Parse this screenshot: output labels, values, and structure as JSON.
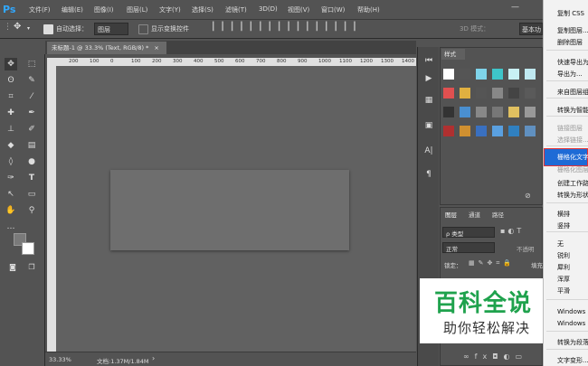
{
  "app": {
    "logo": "Ps"
  },
  "menu": [
    "文件(F)",
    "编辑(E)",
    "图像(I)",
    "图层(L)",
    "文字(Y)",
    "选择(S)",
    "滤镜(T)",
    "3D(D)",
    "视图(V)",
    "窗口(W)",
    "帮助(H)"
  ],
  "options": {
    "auto_select": "自动选择：",
    "auto_select_value": "图层",
    "show_transform": "显示变换控件",
    "mode_3d": "3D 模式：",
    "workspace": "基本功"
  },
  "document": {
    "tab_title": "未标题-1 @ 33.3% (Text, RGB/8) *",
    "close": "×"
  },
  "ruler_ticks": [
    "200",
    "100",
    "0",
    "100",
    "200",
    "300",
    "400",
    "500",
    "600",
    "700",
    "800",
    "900",
    "1000",
    "1100",
    "1200",
    "1300",
    "1400"
  ],
  "status": {
    "zoom": "33.33%",
    "doc": "文档:1.37M/1.84M"
  },
  "styles_panel": {
    "tab": "样式"
  },
  "layers_panel": {
    "tabs": [
      "图层",
      "通道",
      "路径"
    ],
    "filter": "ρ 类型",
    "blend": "正常",
    "opacity": "不透明",
    "lock": "锁定：",
    "fill": "填充"
  },
  "context_menu": [
    {
      "label": "复制 CSS",
      "disabled": false
    },
    {
      "label": "复制图层...",
      "disabled": false
    },
    {
      "label": "删除图层",
      "disabled": false
    },
    {
      "label": "快速导出为...",
      "disabled": false
    },
    {
      "label": "导出为...",
      "disabled": false
    },
    {
      "label": "来自图层组...",
      "disabled": false
    },
    {
      "label": "转换为智能...",
      "disabled": false
    },
    {
      "label": "链接图层",
      "disabled": true
    },
    {
      "label": "选择链接...",
      "disabled": true
    },
    {
      "label": "栅格化文字",
      "disabled": false,
      "highlighted": true
    },
    {
      "label": "栅格化图层...",
      "disabled": true
    },
    {
      "label": "创建工作路径",
      "disabled": false
    },
    {
      "label": "转换为形状",
      "disabled": false
    },
    {
      "label": "横排",
      "disabled": false
    },
    {
      "label": "竖排",
      "disabled": false
    },
    {
      "label": "无",
      "disabled": false
    },
    {
      "label": "锐利",
      "disabled": false
    },
    {
      "label": "犀利",
      "disabled": false
    },
    {
      "label": "浑厚",
      "disabled": false
    },
    {
      "label": "平滑",
      "disabled": false
    },
    {
      "label": "Windows",
      "disabled": false
    },
    {
      "label": "Windows",
      "disabled": false
    },
    {
      "label": "转换为段落...",
      "disabled": false
    },
    {
      "label": "文字变形...",
      "disabled": false
    }
  ],
  "watermark": {
    "title": "百科全说",
    "subtitle": "助你轻松解决"
  },
  "colors": {
    "accent": "#1e6bd6",
    "watermark_green": "#1fa24d"
  }
}
